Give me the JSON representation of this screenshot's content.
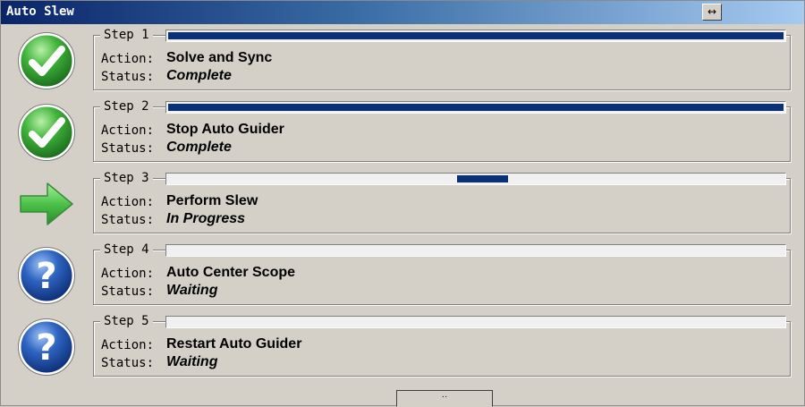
{
  "window": {
    "title": "Auto Slew",
    "title_button_glyph": "↔",
    "bottom_button_glyph": "··"
  },
  "labels": {
    "action": "Action:",
    "status": "Status:"
  },
  "steps": [
    {
      "label": "Step 1",
      "action": "Solve and Sync",
      "status": "Complete",
      "icon": "check-icon",
      "progress": 1.0,
      "mode": "determinate"
    },
    {
      "label": "Step 2",
      "action": "Stop Auto Guider",
      "status": "Complete",
      "icon": "check-icon",
      "progress": 1.0,
      "mode": "determinate"
    },
    {
      "label": "Step 3",
      "action": "Perform Slew",
      "status": "In Progress",
      "icon": "arrow-right-icon",
      "progress": 0.47,
      "mode": "marquee"
    },
    {
      "label": "Step 4",
      "action": "Auto Center Scope",
      "status": "Waiting",
      "icon": "question-icon",
      "progress": 0,
      "mode": "determinate"
    },
    {
      "label": "Step 5",
      "action": "Restart Auto Guider",
      "status": "Waiting",
      "icon": "question-icon",
      "progress": 0,
      "mode": "determinate"
    }
  ],
  "colors": {
    "progress_fill": "#0a3177",
    "check_green": "#2f9e2f",
    "question_blue": "#2456a8",
    "arrow_green": "#4cc24a"
  }
}
